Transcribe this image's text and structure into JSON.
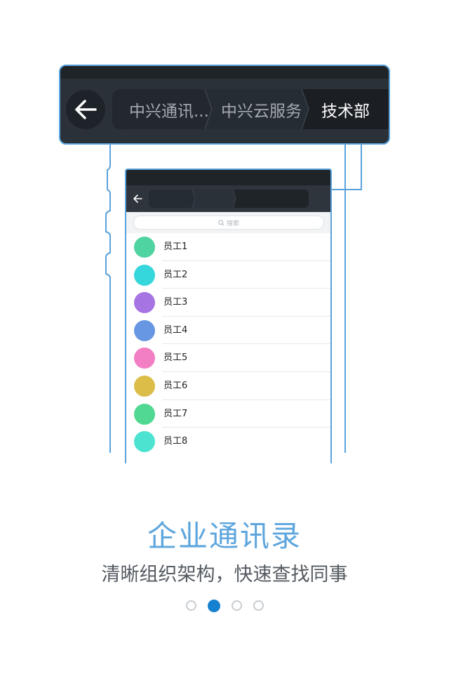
{
  "breadcrumb": {
    "items": [
      {
        "label": "中兴通讯..."
      },
      {
        "label": "中兴云服务"
      },
      {
        "label": "技术部"
      }
    ]
  },
  "search": {
    "placeholder": "搜索"
  },
  "employees": [
    {
      "name": "员工1",
      "color": "#4fd3a1"
    },
    {
      "name": "员工2",
      "color": "#36d6dd"
    },
    {
      "name": "员工3",
      "color": "#a774e3"
    },
    {
      "name": "员工4",
      "color": "#6797e3"
    },
    {
      "name": "员工5",
      "color": "#f27fc4"
    },
    {
      "name": "员工6",
      "color": "#dbbd48"
    },
    {
      "name": "员工7",
      "color": "#51d892"
    },
    {
      "name": "员工8",
      "color": "#4de3d1"
    }
  ],
  "title": "企业通讯录",
  "subtitle": "清晰组织架构，快速查找同事",
  "pagination": {
    "current": 2,
    "total": 4
  },
  "colors": {
    "accent": "#5aa2dc",
    "active_dot": "#1681d0",
    "title": "#5ea6dd"
  }
}
